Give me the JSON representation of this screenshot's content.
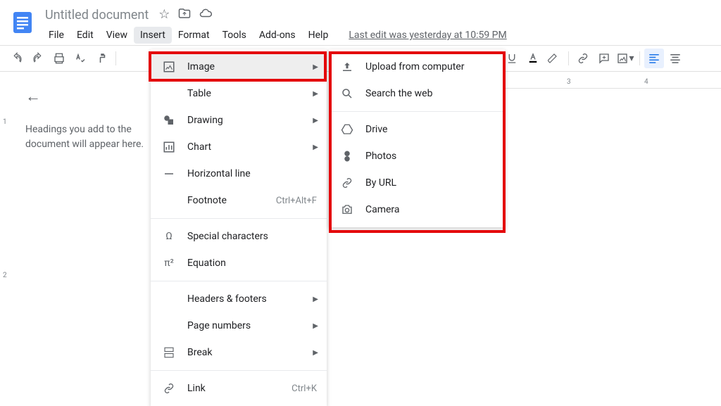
{
  "doc_title": "Untitled document",
  "menubar": {
    "file": "File",
    "edit": "Edit",
    "view": "View",
    "insert": "Insert",
    "format": "Format",
    "tools": "Tools",
    "addons": "Add-ons",
    "help": "Help"
  },
  "last_edit": "Last edit was yesterday at 10:59 PM",
  "outline_hint": "Headings you add to the document will appear here.",
  "insert_menu": {
    "image": "Image",
    "table": "Table",
    "drawing": "Drawing",
    "chart": "Chart",
    "horizontal_line": "Horizontal line",
    "footnote": "Footnote",
    "footnote_shortcut": "Ctrl+Alt+F",
    "special_characters": "Special characters",
    "equation": "Equation",
    "headers_footers": "Headers & footers",
    "page_numbers": "Page numbers",
    "break": "Break",
    "link": "Link",
    "link_shortcut": "Ctrl+K"
  },
  "image_submenu": {
    "upload": "Upload from computer",
    "search": "Search the web",
    "drive": "Drive",
    "photos": "Photos",
    "by_url": "By URL",
    "camera": "Camera"
  },
  "ruler": {
    "r3": "3",
    "r4": "4"
  },
  "vruler": {
    "v1": "1",
    "v2": "2"
  }
}
